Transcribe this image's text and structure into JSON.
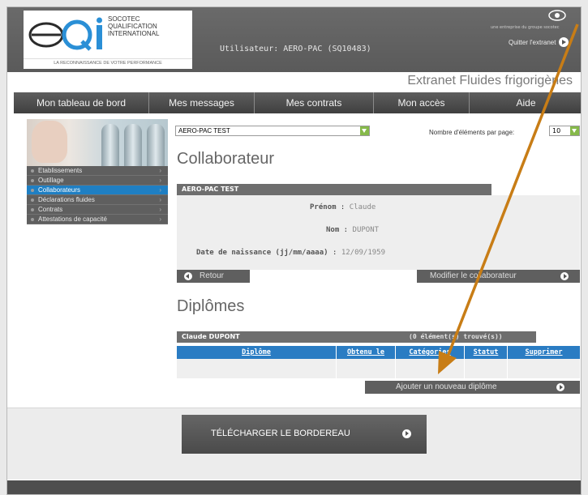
{
  "header": {
    "logo_lines": [
      "SOCOTEC",
      "QUALIFICATION",
      "INTERNATIONAL"
    ],
    "logo_tagline": "LA RECONNAISSANCE DE VOTRE PERFORMANCE",
    "user_label": "Utilisateur: AERO-PAC (SQ10483)",
    "group_text": "une entreprise du groupe socotec",
    "logout_label": "Quitter l'extranet",
    "site_title": "Extranet Fluides frigorigènes"
  },
  "nav": {
    "items": [
      {
        "label": "Mon tableau de bord"
      },
      {
        "label": "Mes messages"
      },
      {
        "label": "Mes contrats"
      },
      {
        "label": "Mon accès"
      },
      {
        "label": "Aide"
      }
    ]
  },
  "sidebar": {
    "items": [
      {
        "label": "Etablissements",
        "active": false
      },
      {
        "label": "Outillage",
        "active": false
      },
      {
        "label": "Collaborateurs",
        "active": true
      },
      {
        "label": "Déclarations fluides",
        "active": false
      },
      {
        "label": "Contrats",
        "active": false
      },
      {
        "label": "Attestations de capacité",
        "active": false
      }
    ]
  },
  "filters": {
    "company_selected": "AERO-PAC TEST",
    "per_page_label": "Nombre d'éléments par page:",
    "per_page_value": "10"
  },
  "collaborateur": {
    "heading": "Collaborateur",
    "tab_label": "AERO-PAC TEST",
    "prenom_label": "Prénom",
    "prenom_value": "Claude",
    "nom_label": "Nom",
    "nom_value": "DUPONT",
    "birth_label": "Date de naissance (jj/mm/aaaa)",
    "birth_value": "12/09/1959",
    "back_label": "Retour",
    "edit_label": "Modifier le collaborateur"
  },
  "diplomes": {
    "heading": "Diplômes",
    "tab_label": "Claude DUPONT",
    "count_text": "(0 élément(s) trouvé(s))",
    "columns": [
      "Diplôme",
      "Obtenu le",
      "Catégories",
      "Statut",
      "Supprimer"
    ],
    "add_label": "Ajouter un nouveau diplôme"
  },
  "download": {
    "label": "TÉLÉCHARGER LE BORDEREAU"
  },
  "colors": {
    "accent_blue": "#2a7cc3",
    "nav_dark": "#4a4a4a",
    "annotation_arrow": "#c87d16"
  }
}
